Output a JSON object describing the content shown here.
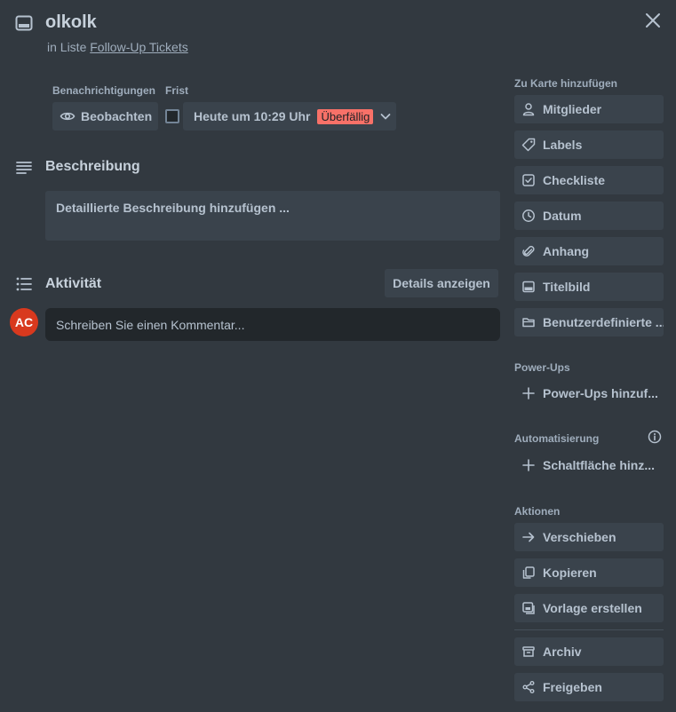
{
  "header": {
    "title": "olkolk",
    "list_prefix": "in Liste",
    "list_name": "Follow-Up Tickets"
  },
  "notifications": {
    "label": "Benachrichtigungen",
    "watch_label": "Beobachten"
  },
  "due": {
    "label": "Frist",
    "date_text": "Heute um 10:29 Uhr",
    "badge": "Überfällig",
    "badge_color": "#f87168"
  },
  "description": {
    "title": "Beschreibung",
    "placeholder": "Detaillierte Beschreibung hinzufügen ..."
  },
  "activity": {
    "title": "Aktivität",
    "details_button": "Details anzeigen",
    "avatar_initials": "AC",
    "avatar_color": "#d8391e",
    "comment_placeholder": "Schreiben Sie einen Kommentar..."
  },
  "sidebar": {
    "add_to_card_label": "Zu Karte hinzufügen",
    "add_items": [
      {
        "label": "Mitglieder",
        "icon": "person-icon"
      },
      {
        "label": "Labels",
        "icon": "tag-icon"
      },
      {
        "label": "Checkliste",
        "icon": "checkbox-icon"
      },
      {
        "label": "Datum",
        "icon": "clock-icon"
      },
      {
        "label": "Anhang",
        "icon": "paperclip-icon"
      },
      {
        "label": "Titelbild",
        "icon": "cover-icon"
      },
      {
        "label": "Benutzerdefinierte ...",
        "icon": "folder-icon"
      }
    ],
    "powerups_label": "Power-Ups",
    "powerups_button": "Power-Ups hinzuf...",
    "automation_label": "Automatisierung",
    "automation_button": "Schaltfläche hinz...",
    "actions_label": "Aktionen",
    "action_items": [
      {
        "label": "Verschieben",
        "icon": "arrow-right-icon"
      },
      {
        "label": "Kopieren",
        "icon": "copy-icon"
      },
      {
        "label": "Vorlage erstellen",
        "icon": "template-icon"
      }
    ],
    "archive_label": "Archiv",
    "share_label": "Freigeben"
  },
  "colors": {
    "background": "#323940",
    "button": "#3a434c",
    "text": "#b6c2cf"
  }
}
